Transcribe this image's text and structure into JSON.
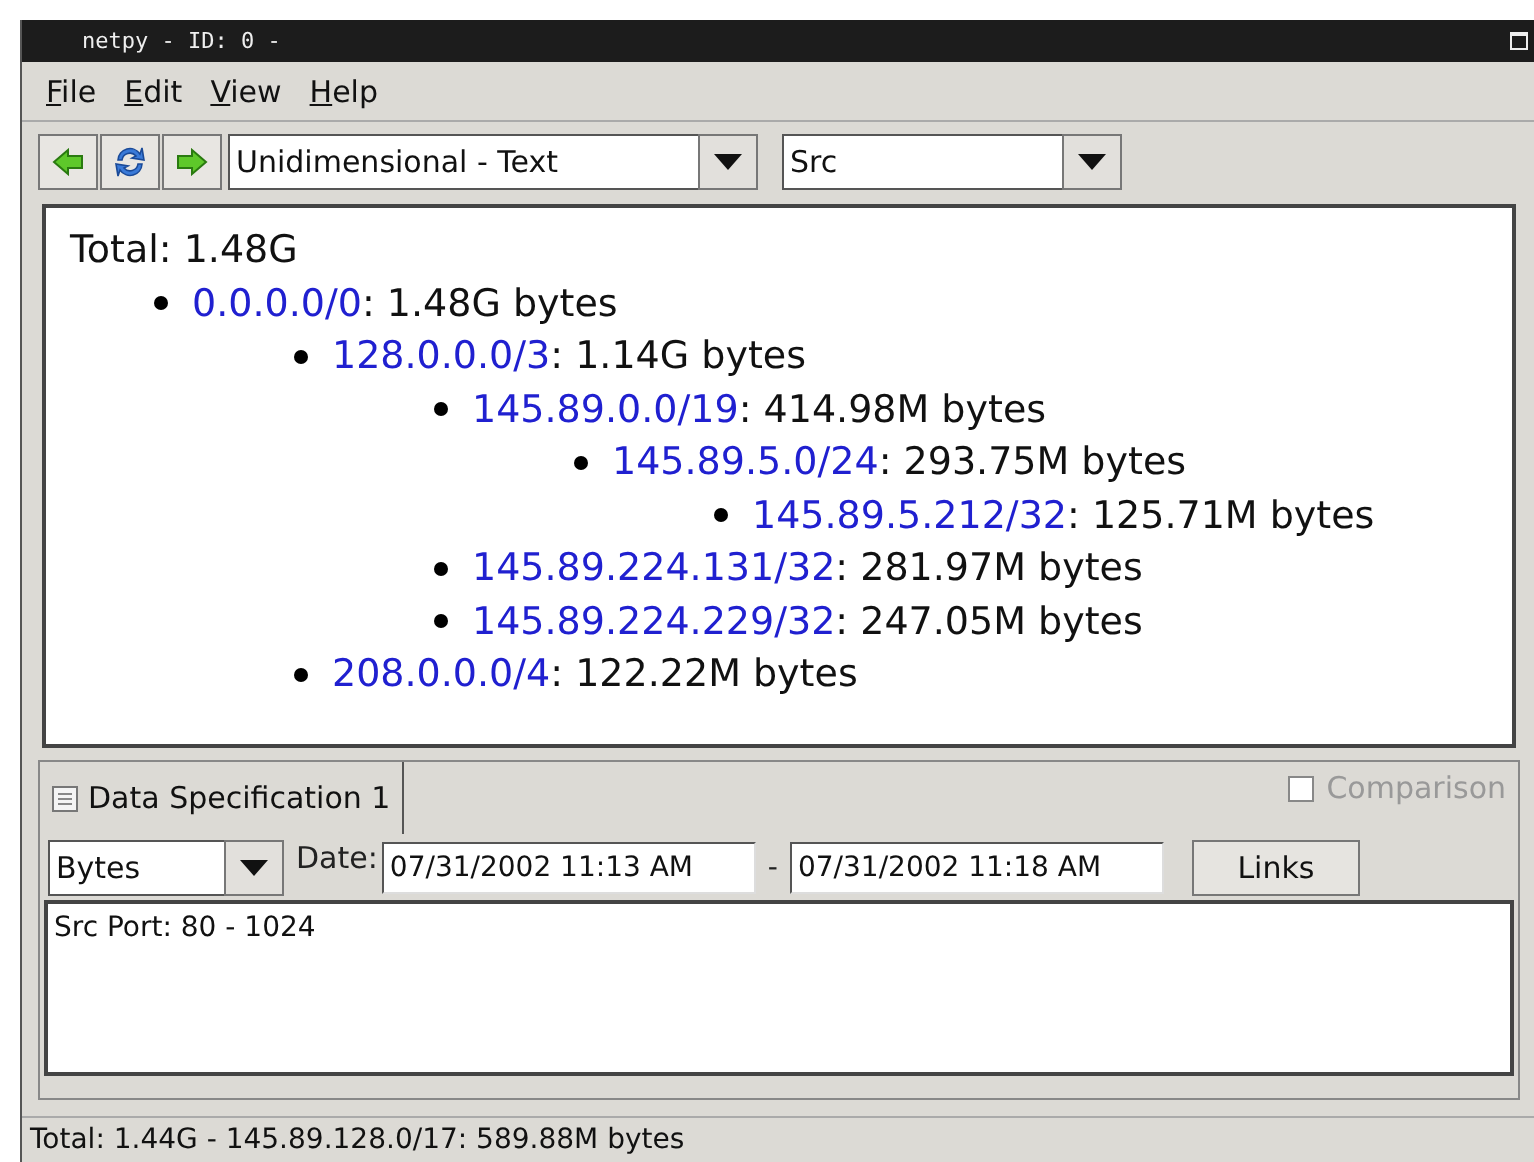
{
  "window": {
    "title": "netpy - ID: 0 -"
  },
  "menu": [
    "File",
    "Edit",
    "View",
    "Help"
  ],
  "toolbar": {
    "view_select": "Unidimensional - Text",
    "field_select": "Src"
  },
  "tree": {
    "total_label": "Total: 1.48G",
    "items": [
      {
        "label": "0.0.0.0/0",
        "text": ": 1.48G bytes",
        "children": [
          {
            "label": "128.0.0.0/3",
            "text": ": 1.14G bytes",
            "children": [
              {
                "label": "145.89.0.0/19",
                "text": ": 414.98M bytes",
                "children": [
                  {
                    "label": "145.89.5.0/24",
                    "text": ": 293.75M bytes",
                    "children": [
                      {
                        "label": "145.89.5.212/32",
                        "text": ": 125.71M bytes"
                      }
                    ]
                  }
                ]
              },
              {
                "label": "145.89.224.131/32",
                "text": ": 281.97M bytes"
              },
              {
                "label": "145.89.224.229/32",
                "text": ": 247.05M bytes"
              }
            ]
          },
          {
            "label": "208.0.0.0/4",
            "text": ": 122.22M bytes"
          }
        ]
      }
    ]
  },
  "spec": {
    "tab": "Data Specification 1",
    "comparison": {
      "label": "Comparison",
      "checked": false,
      "disabled": true
    },
    "unit": "Bytes",
    "date_label": "Date:",
    "date_from": "07/31/2002 11:13 AM",
    "separator": "-",
    "date_to": "07/31/2002 11:18 AM",
    "links_button": "Links",
    "filter_text": "Src Port: 80 - 1024"
  },
  "status_bar": "Total: 1.44G - 145.89.128.0/17: 589.88M bytes"
}
